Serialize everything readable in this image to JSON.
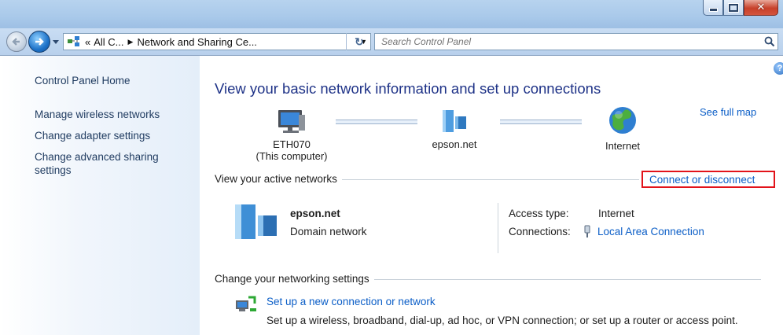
{
  "window": {
    "min_icon": "minimize-icon",
    "max_icon": "maximize-icon",
    "close_icon": "close-icon",
    "close_color": "#c7402a"
  },
  "nav": {
    "address": {
      "chevron": "«",
      "crumb1": "All C...",
      "sep": "▶",
      "crumb2": "Network and Sharing Ce...",
      "dropdown": "▼"
    },
    "refresh": "↻",
    "search_placeholder": "Search Control Panel"
  },
  "sidebar": {
    "home": "Control Panel Home",
    "items": [
      "Manage wireless networks",
      "Change adapter settings",
      "Change advanced sharing",
      "settings"
    ]
  },
  "main": {
    "help": "?",
    "title": "View your basic network information and set up connections",
    "see_full_map": "See full map",
    "map": {
      "computer_name": "ETH070",
      "computer_sub": "(This computer)",
      "network_name": "epson.net",
      "internet": "Internet"
    },
    "active_networks_header": "View your active networks",
    "connect_disconnect": "Connect or disconnect",
    "highlight_color": "#e2131a",
    "network": {
      "name": "epson.net",
      "category": "Domain network",
      "access_type_label": "Access type:",
      "access_type_value": "Internet",
      "connections_label": "Connections:",
      "connections_value": "Local Area Connection"
    },
    "change_header": "Change your networking settings",
    "task": {
      "link": "Set up a new connection or network",
      "description": "Set up a wireless, broadband, dial-up, ad hoc, or VPN connection; or set up a router or access point."
    }
  },
  "accent": "#0b5ec7",
  "title_color": "#1e3287"
}
